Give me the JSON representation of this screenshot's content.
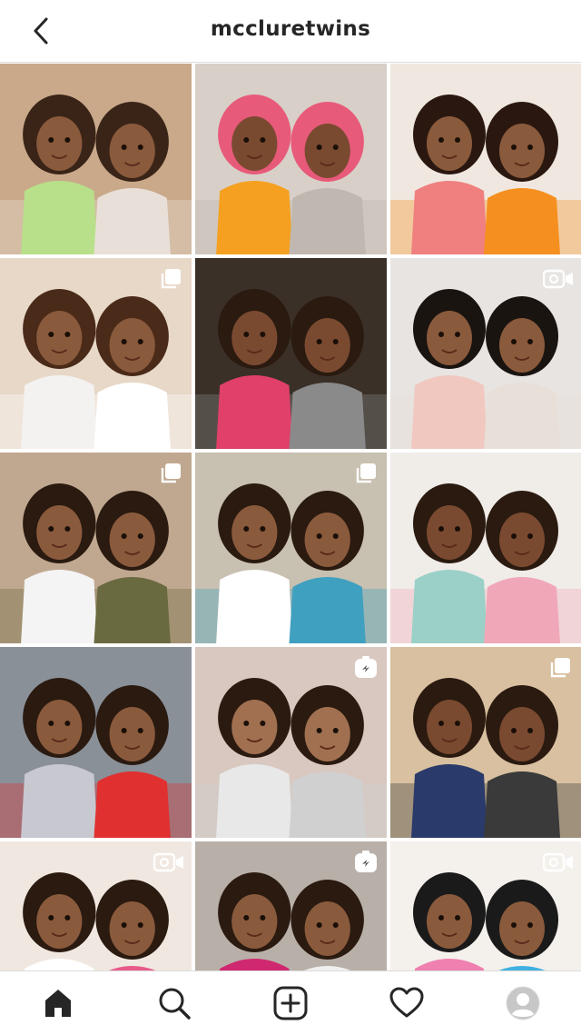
{
  "header": {
    "username": "mccluretwins",
    "back_icon": "chevron-left-icon"
  },
  "grid": {
    "posts": [
      {
        "type": "image",
        "palette": [
          "#c9a98a",
          "#3a2418",
          "#b8e08a",
          "#e8e0d8"
        ],
        "skin": "#8a5a3c"
      },
      {
        "type": "image",
        "palette": [
          "#d8d0c8",
          "#e85a7a",
          "#f5a020",
          "#c0b8b0"
        ],
        "skin": "#7a4a30"
      },
      {
        "type": "image",
        "palette": [
          "#f0e8e0",
          "#2a1810",
          "#f08080",
          "#f59020"
        ],
        "skin": "#8a5a3c"
      },
      {
        "type": "carousel",
        "palette": [
          "#e8d8c8",
          "#4a2a18",
          "#f4f2f0",
          "#ffffff"
        ],
        "skin": "#8a5a3c"
      },
      {
        "type": "image",
        "palette": [
          "#3a3028",
          "#2a1a10",
          "#e0406a",
          "#8a8a8a"
        ],
        "skin": "#7a4a30"
      },
      {
        "type": "video",
        "palette": [
          "#e8e4e2",
          "#1a1410",
          "#f0c8c0",
          "#e8e0d8"
        ],
        "skin": "#8a5a3c"
      },
      {
        "type": "carousel",
        "palette": [
          "#c0a890",
          "#2a1a10",
          "#f4f4f4",
          "#6a6a40"
        ],
        "skin": "#8a5a3c"
      },
      {
        "type": "carousel",
        "palette": [
          "#c8c0b0",
          "#2a1a10",
          "#ffffff",
          "#40a0c0"
        ],
        "skin": "#8a5a3c"
      },
      {
        "type": "image",
        "palette": [
          "#f0ece8",
          "#2a1a10",
          "#9ad0c8",
          "#f0a8b8"
        ],
        "skin": "#7a4a30"
      },
      {
        "type": "image",
        "palette": [
          "#8a9098",
          "#2a1a10",
          "#c8c8d0",
          "#e03030"
        ],
        "skin": "#8a5a3c"
      },
      {
        "type": "reel",
        "palette": [
          "#d8c8c0",
          "#2a1a10",
          "#e8e8e8",
          "#d0d0d0"
        ],
        "skin": "#a07050"
      },
      {
        "type": "carousel",
        "palette": [
          "#d8c0a0",
          "#2a1a10",
          "#2a3a6a",
          "#3a3a3a"
        ],
        "skin": "#7a4a30"
      },
      {
        "type": "video",
        "palette": [
          "#f0e8e0",
          "#2a1a10",
          "#ffffff",
          "#e85a8a"
        ],
        "skin": "#8a5a3c"
      },
      {
        "type": "reel",
        "palette": [
          "#b8b0a8",
          "#2a1a10",
          "#d02870",
          "#f0f0f0"
        ],
        "skin": "#8a5a3c"
      },
      {
        "type": "video",
        "palette": [
          "#f4f0ec",
          "#1a1a1a",
          "#f080b0",
          "#40b0e0"
        ],
        "skin": "#8a5a3c"
      }
    ]
  },
  "bottom_nav": {
    "items": [
      {
        "name": "home",
        "icon": "home-icon"
      },
      {
        "name": "search",
        "icon": "search-icon"
      },
      {
        "name": "new-post",
        "icon": "plus-square-icon"
      },
      {
        "name": "activity",
        "icon": "heart-icon"
      },
      {
        "name": "profile",
        "icon": "avatar-icon"
      }
    ]
  }
}
